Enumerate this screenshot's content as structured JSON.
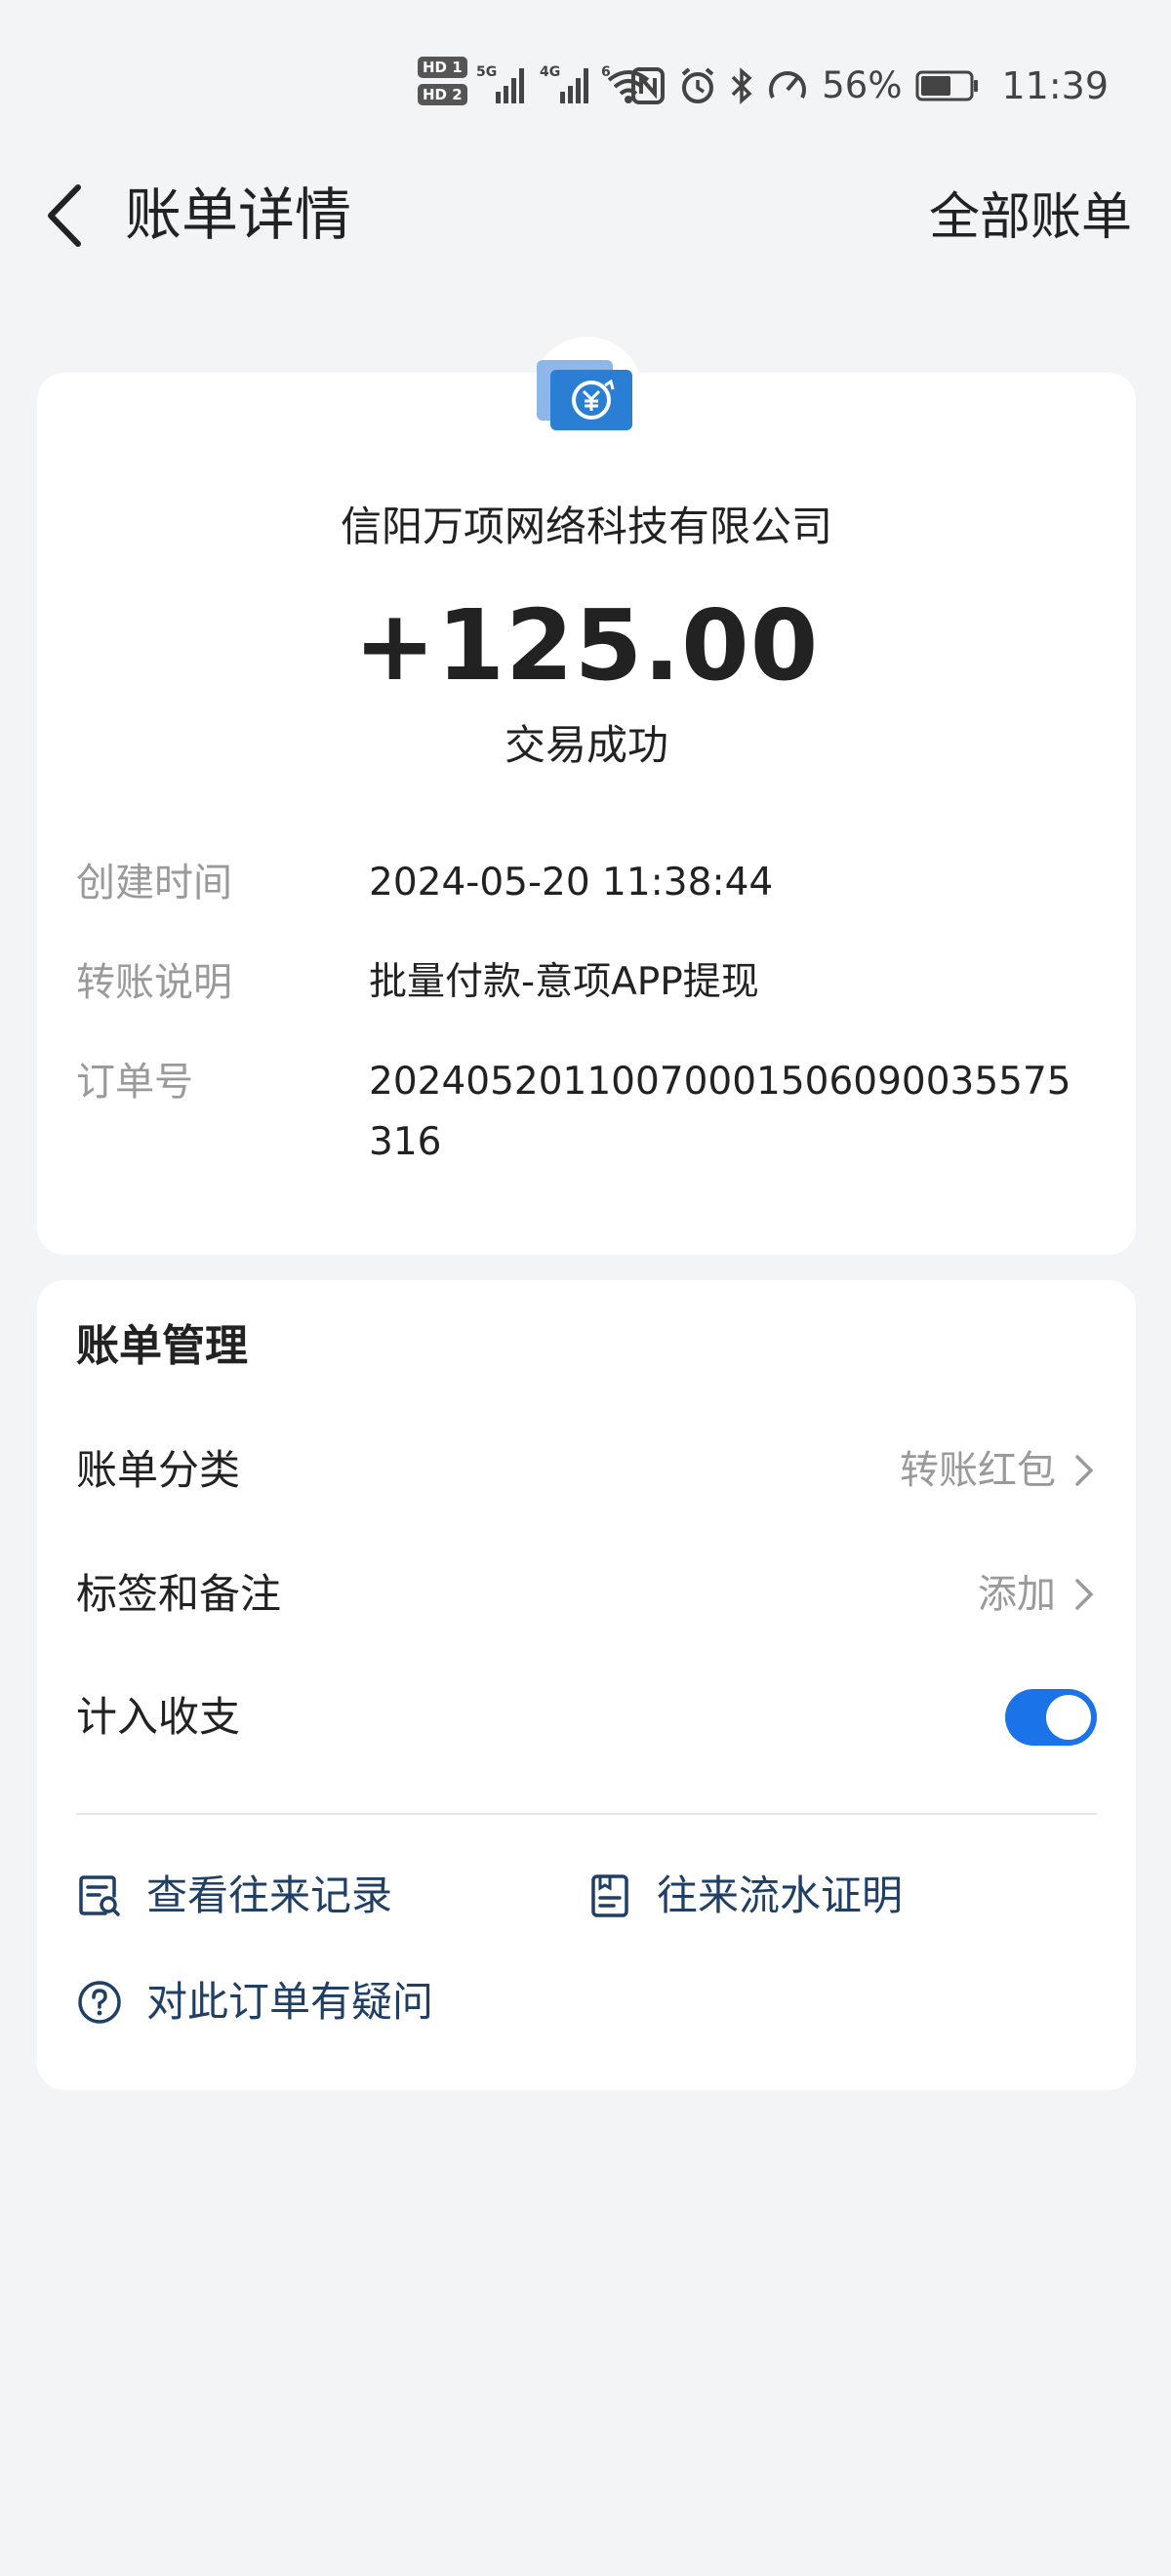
{
  "status_bar": {
    "sim1_label": "HD 1",
    "sim2_label": "HD 2",
    "net1_label": "5G",
    "net2_label": "4G",
    "wifi_label": "6",
    "battery_percent": "56%",
    "time": "11:39",
    "icons": [
      "nfc-icon",
      "alarm-icon",
      "bluetooth-icon",
      "speed-icon",
      "battery-icon"
    ]
  },
  "header": {
    "title": "账单详情",
    "right_action": "全部账单"
  },
  "detail": {
    "merchant": "信阳万项网络科技有限公司",
    "amount": "+125.00",
    "status": "交易成功",
    "rows": [
      {
        "label": "创建时间",
        "value": "2024-05-20 11:38:44"
      },
      {
        "label": "转账说明",
        "value": "批量付款-意项APP提现"
      },
      {
        "label": "订单号",
        "value": "20240520110070001506090035575316"
      }
    ]
  },
  "manage": {
    "title": "账单管理",
    "category_label": "账单分类",
    "category_value": "转账红包",
    "tags_label": "标签和备注",
    "tags_value": "添加",
    "include_label": "计入收支",
    "include_enabled": true,
    "links": {
      "records": "查看往来记录",
      "statement": "往来流水证明",
      "question": "对此订单有疑问"
    }
  },
  "colors": {
    "accent": "#1a73e8",
    "link": "#1f3f66",
    "background": "#f3f4f5",
    "muted": "#9a9a9a"
  }
}
